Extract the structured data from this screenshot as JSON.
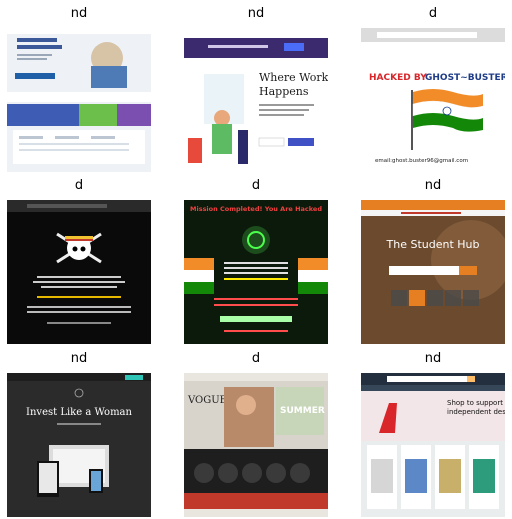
{
  "labels": [
    "nd",
    "nd",
    "d",
    "d",
    "d",
    "nd",
    "nd",
    "d",
    "nd"
  ],
  "thumbs": {
    "t2_heading": [
      "Where Work",
      "Happens"
    ],
    "t3_banner_red": "HACKED BY",
    "t3_banner_blue": "GHOST~BUSTER",
    "t3_email": "email:ghost.buster96@gmail.com",
    "t5_title": "Mission Completed! You Are Hacked",
    "t6_title": "The Student Hub",
    "t7_title": "Invest Like a Woman",
    "t8_brand": "VOGUE",
    "t8_sale": "SUMMER",
    "t9_heading": [
      "Shop to support",
      "independent designers"
    ]
  },
  "colors": {
    "bg": "#ffffff",
    "label": "#000000",
    "flag_saffron": "#f28c28",
    "flag_green": "#138808",
    "hacked_red": "#d8262a",
    "slack_purple": "#3b2b6e",
    "amazon_dark": "#232f3e"
  }
}
